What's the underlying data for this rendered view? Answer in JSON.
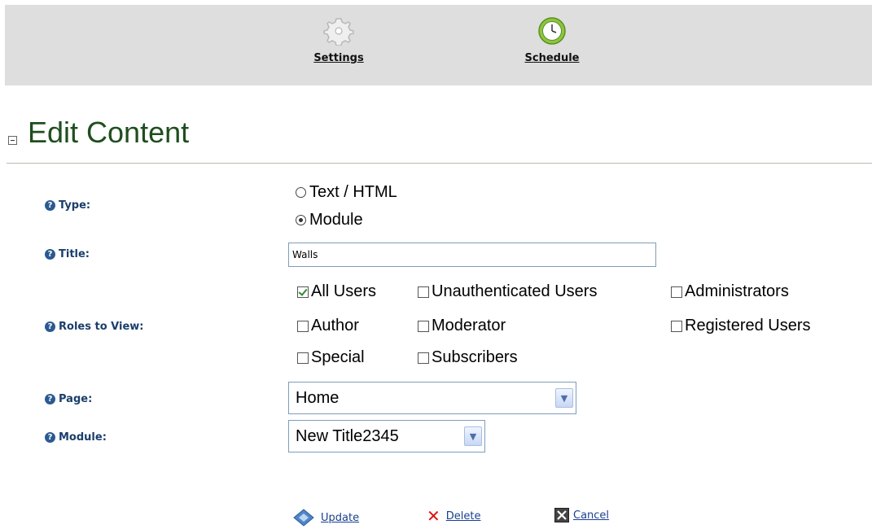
{
  "topbar": {
    "settings_label": "Settings",
    "schedule_label": "Schedule"
  },
  "page": {
    "title": "Edit Content"
  },
  "form": {
    "type_label": "Type:",
    "type_options": [
      "Text / HTML",
      "Module"
    ],
    "type_selected": "Module",
    "title_label": "Title:",
    "title_value": "Walls",
    "roles_label": "Roles to View:",
    "roles": [
      {
        "label": "All Users",
        "checked": true
      },
      {
        "label": "Unauthenticated Users",
        "checked": false
      },
      {
        "label": "Administrators",
        "checked": false
      },
      {
        "label": "Author",
        "checked": false
      },
      {
        "label": "Moderator",
        "checked": false
      },
      {
        "label": "Registered Users",
        "checked": false
      },
      {
        "label": "Special",
        "checked": false
      },
      {
        "label": "Subscribers",
        "checked": false
      }
    ],
    "page_label": "Page:",
    "page_value": "Home",
    "module_label": "Module:",
    "module_value": "New Title2345"
  },
  "actions": {
    "update_label": "Update",
    "delete_label": "Delete",
    "cancel_label": "Cancel"
  },
  "icons": {
    "settings": "gear-icon",
    "schedule": "clock-icon",
    "help": "help-icon",
    "update": "update-icon",
    "delete": "delete-x-icon",
    "cancel": "cancel-icon"
  },
  "colors": {
    "title": "#1e4e1e",
    "label": "#1b3e6b",
    "link": "#1a3f8f",
    "topbar": "#dedede"
  }
}
